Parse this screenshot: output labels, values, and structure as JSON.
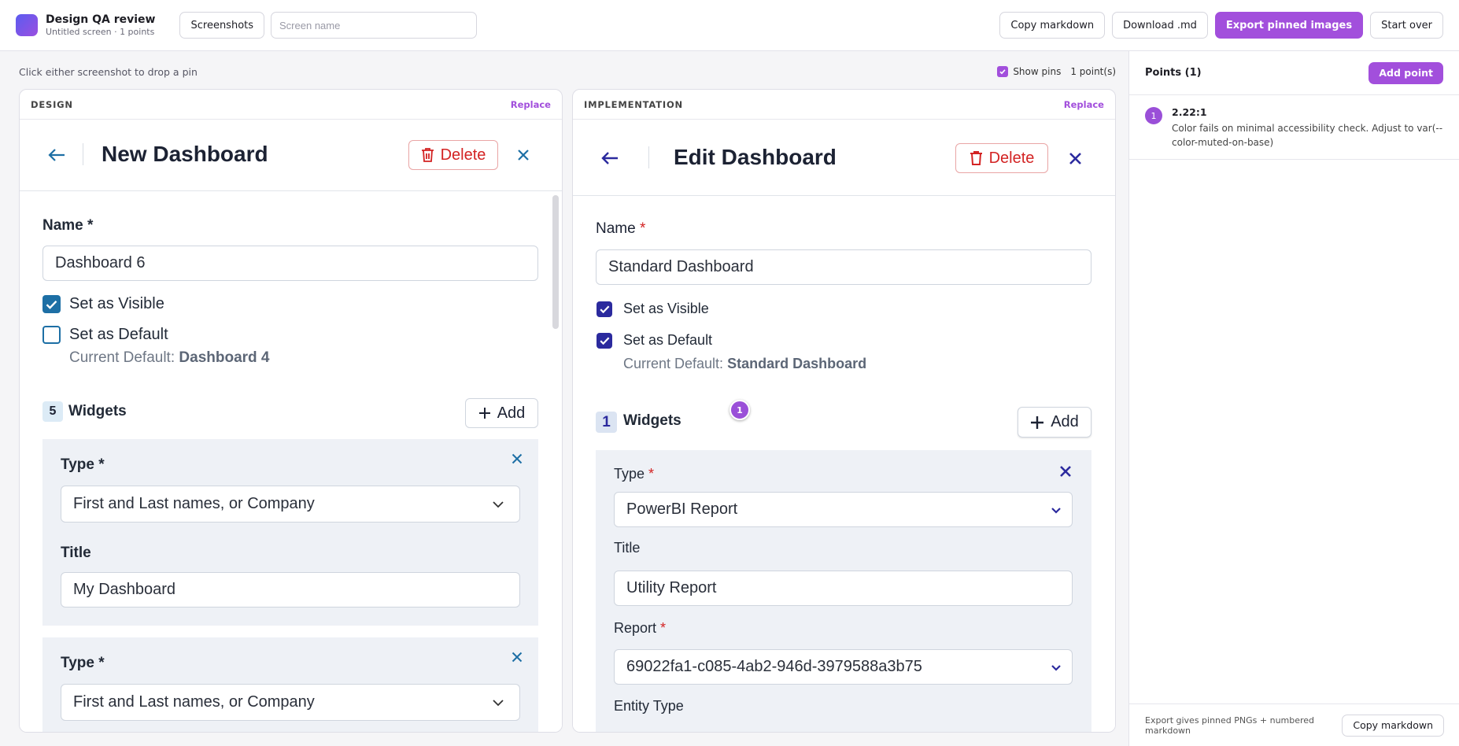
{
  "app": {
    "title": "Design QA review",
    "subtitle": "Untitled screen · 1 points"
  },
  "toolbar": {
    "screenshots_label": "Screenshots",
    "screen_name_placeholder": "Screen name",
    "copy_markdown_label": "Copy markdown",
    "download_md_label": "Download .md",
    "export_label": "Export pinned images",
    "start_over_label": "Start over"
  },
  "main": {
    "hint": "Click either screenshot to drop a pin",
    "show_pins_label": "Show pins",
    "show_pins_checked": true,
    "point_count": "1 point(s)"
  },
  "design": {
    "header": "DESIGN",
    "replace_label": "Replace",
    "page_title": "New Dashboard",
    "delete_label": "Delete",
    "name_label": "Name *",
    "name_value": "Dashboard 6",
    "visible_label": "Set as Visible",
    "visible_checked": true,
    "default_label": "Set as Default",
    "default_checked": false,
    "current_default_prefix": "Current Default:",
    "current_default_value": "Dashboard 4",
    "widget_count": "5",
    "widgets_label": "Widgets",
    "add_label": "Add",
    "widgets": [
      {
        "type_label": "Type *",
        "type_value": "First and Last names, or Company",
        "title_label": "Title",
        "title_value": "My Dashboard"
      },
      {
        "type_label": "Type *",
        "type_value": "First and Last names, or Company"
      }
    ]
  },
  "implementation": {
    "header": "IMPLEMENTATION",
    "replace_label": "Replace",
    "page_title": "Edit Dashboard",
    "delete_label": "Delete",
    "name_label": "Name",
    "name_value": "Standard Dashboard",
    "visible_label": "Set as Visible",
    "visible_checked": true,
    "default_label": "Set as Default",
    "default_checked": true,
    "current_default_prefix": "Current Default:",
    "current_default_value": "Standard Dashboard",
    "widget_count": "1",
    "widgets_label": "Widgets",
    "add_label": "Add",
    "widget": {
      "type_label": "Type",
      "type_value": "PowerBI Report",
      "title_label": "Title",
      "title_value": "Utility Report",
      "report_label": "Report",
      "report_value": "69022fa1-c085-4ab2-946d-3979588a3b75",
      "entity_type_label": "Entity Type"
    },
    "pin_number": "1"
  },
  "points_panel": {
    "title": "Points (1)",
    "add_point_label": "Add point",
    "points": [
      {
        "number": "1",
        "title": "2.22:1",
        "body": "Color fails on minimal accessibility check. Adjust to var(--color-muted-on-base)"
      }
    ],
    "footer_hint": "Export gives pinned PNGs + numbered markdown",
    "copy_markdown_label": "Copy markdown"
  },
  "colors": {
    "accent": "#a24fdc",
    "design_blue": "#1d6fa5",
    "impl_navy": "#2b2a9e",
    "danger": "#d32323"
  }
}
